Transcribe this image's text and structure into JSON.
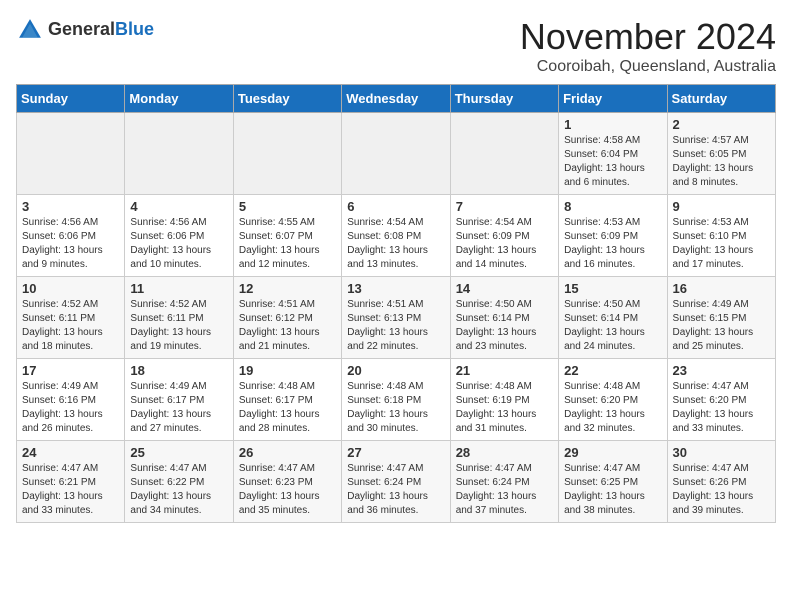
{
  "logo": {
    "general": "General",
    "blue": "Blue"
  },
  "title": "November 2024",
  "location": "Cooroibah, Queensland, Australia",
  "weekdays": [
    "Sunday",
    "Monday",
    "Tuesday",
    "Wednesday",
    "Thursday",
    "Friday",
    "Saturday"
  ],
  "weeks": [
    [
      {
        "day": "",
        "info": ""
      },
      {
        "day": "",
        "info": ""
      },
      {
        "day": "",
        "info": ""
      },
      {
        "day": "",
        "info": ""
      },
      {
        "day": "",
        "info": ""
      },
      {
        "day": "1",
        "info": "Sunrise: 4:58 AM\nSunset: 6:04 PM\nDaylight: 13 hours and 6 minutes."
      },
      {
        "day": "2",
        "info": "Sunrise: 4:57 AM\nSunset: 6:05 PM\nDaylight: 13 hours and 8 minutes."
      }
    ],
    [
      {
        "day": "3",
        "info": "Sunrise: 4:56 AM\nSunset: 6:06 PM\nDaylight: 13 hours and 9 minutes."
      },
      {
        "day": "4",
        "info": "Sunrise: 4:56 AM\nSunset: 6:06 PM\nDaylight: 13 hours and 10 minutes."
      },
      {
        "day": "5",
        "info": "Sunrise: 4:55 AM\nSunset: 6:07 PM\nDaylight: 13 hours and 12 minutes."
      },
      {
        "day": "6",
        "info": "Sunrise: 4:54 AM\nSunset: 6:08 PM\nDaylight: 13 hours and 13 minutes."
      },
      {
        "day": "7",
        "info": "Sunrise: 4:54 AM\nSunset: 6:09 PM\nDaylight: 13 hours and 14 minutes."
      },
      {
        "day": "8",
        "info": "Sunrise: 4:53 AM\nSunset: 6:09 PM\nDaylight: 13 hours and 16 minutes."
      },
      {
        "day": "9",
        "info": "Sunrise: 4:53 AM\nSunset: 6:10 PM\nDaylight: 13 hours and 17 minutes."
      }
    ],
    [
      {
        "day": "10",
        "info": "Sunrise: 4:52 AM\nSunset: 6:11 PM\nDaylight: 13 hours and 18 minutes."
      },
      {
        "day": "11",
        "info": "Sunrise: 4:52 AM\nSunset: 6:11 PM\nDaylight: 13 hours and 19 minutes."
      },
      {
        "day": "12",
        "info": "Sunrise: 4:51 AM\nSunset: 6:12 PM\nDaylight: 13 hours and 21 minutes."
      },
      {
        "day": "13",
        "info": "Sunrise: 4:51 AM\nSunset: 6:13 PM\nDaylight: 13 hours and 22 minutes."
      },
      {
        "day": "14",
        "info": "Sunrise: 4:50 AM\nSunset: 6:14 PM\nDaylight: 13 hours and 23 minutes."
      },
      {
        "day": "15",
        "info": "Sunrise: 4:50 AM\nSunset: 6:14 PM\nDaylight: 13 hours and 24 minutes."
      },
      {
        "day": "16",
        "info": "Sunrise: 4:49 AM\nSunset: 6:15 PM\nDaylight: 13 hours and 25 minutes."
      }
    ],
    [
      {
        "day": "17",
        "info": "Sunrise: 4:49 AM\nSunset: 6:16 PM\nDaylight: 13 hours and 26 minutes."
      },
      {
        "day": "18",
        "info": "Sunrise: 4:49 AM\nSunset: 6:17 PM\nDaylight: 13 hours and 27 minutes."
      },
      {
        "day": "19",
        "info": "Sunrise: 4:48 AM\nSunset: 6:17 PM\nDaylight: 13 hours and 28 minutes."
      },
      {
        "day": "20",
        "info": "Sunrise: 4:48 AM\nSunset: 6:18 PM\nDaylight: 13 hours and 30 minutes."
      },
      {
        "day": "21",
        "info": "Sunrise: 4:48 AM\nSunset: 6:19 PM\nDaylight: 13 hours and 31 minutes."
      },
      {
        "day": "22",
        "info": "Sunrise: 4:48 AM\nSunset: 6:20 PM\nDaylight: 13 hours and 32 minutes."
      },
      {
        "day": "23",
        "info": "Sunrise: 4:47 AM\nSunset: 6:20 PM\nDaylight: 13 hours and 33 minutes."
      }
    ],
    [
      {
        "day": "24",
        "info": "Sunrise: 4:47 AM\nSunset: 6:21 PM\nDaylight: 13 hours and 33 minutes."
      },
      {
        "day": "25",
        "info": "Sunrise: 4:47 AM\nSunset: 6:22 PM\nDaylight: 13 hours and 34 minutes."
      },
      {
        "day": "26",
        "info": "Sunrise: 4:47 AM\nSunset: 6:23 PM\nDaylight: 13 hours and 35 minutes."
      },
      {
        "day": "27",
        "info": "Sunrise: 4:47 AM\nSunset: 6:24 PM\nDaylight: 13 hours and 36 minutes."
      },
      {
        "day": "28",
        "info": "Sunrise: 4:47 AM\nSunset: 6:24 PM\nDaylight: 13 hours and 37 minutes."
      },
      {
        "day": "29",
        "info": "Sunrise: 4:47 AM\nSunset: 6:25 PM\nDaylight: 13 hours and 38 minutes."
      },
      {
        "day": "30",
        "info": "Sunrise: 4:47 AM\nSunset: 6:26 PM\nDaylight: 13 hours and 39 minutes."
      }
    ]
  ]
}
